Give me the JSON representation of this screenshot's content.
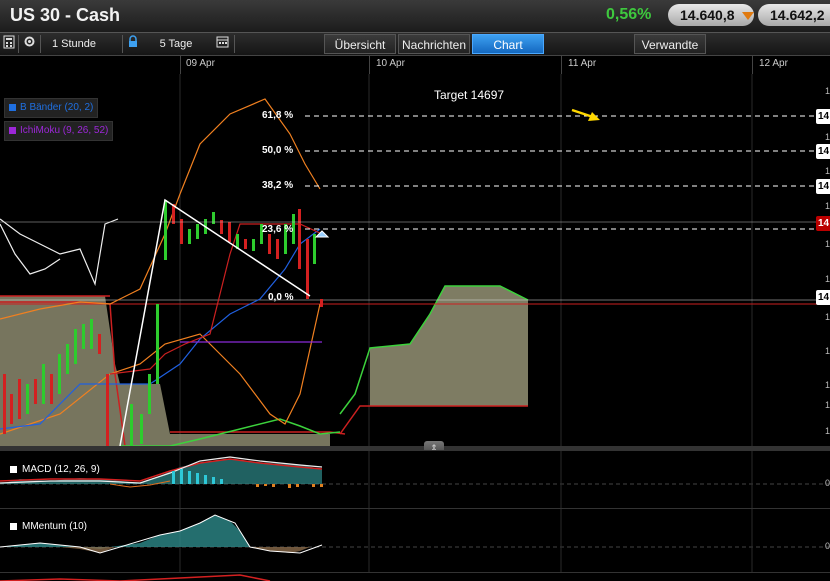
{
  "header": {
    "title": "US 30 - Cash",
    "change_pct": "0,56%",
    "bid": "14.640,8",
    "ask": "14.642,2"
  },
  "toolbar": {
    "interval": "1 Stunde",
    "range": "5 Tage"
  },
  "tabs": [
    {
      "label": "Übersicht",
      "active": false
    },
    {
      "label": "Nachrichten",
      "active": false
    },
    {
      "label": "Chart",
      "active": true
    },
    {
      "label": "Verwandte",
      "active": false
    }
  ],
  "dates": [
    "09 Apr",
    "10 Apr",
    "11 Apr",
    "12 Apr"
  ],
  "legend": [
    {
      "label": "B Bänder (20, 2)",
      "color": "#1f6fe0"
    },
    {
      "label": "IchiMoku (9, 26, 52)",
      "color": "#9c27d8"
    }
  ],
  "target": "Target 14697",
  "fib_levels": [
    "61,8 %",
    "50,0 %",
    "38,2 %",
    "23,6 %",
    "0,0 %"
  ],
  "right_labels": [
    "14",
    "14",
    "14",
    "14",
    "14"
  ],
  "right_ticks": [
    "1",
    "1",
    "1",
    "1",
    "1",
    "1",
    "1",
    "1",
    "1",
    "1",
    "1"
  ],
  "panels": {
    "macd": {
      "label": "MACD (12, 26, 9)",
      "zero": "0"
    },
    "momentum": {
      "label": "MMentum (10)",
      "zero": "0"
    }
  },
  "colors": {
    "accent": "#1f88e5",
    "up": "#2ecc2e",
    "down": "#d42020",
    "positive": "#3ec83e"
  }
}
